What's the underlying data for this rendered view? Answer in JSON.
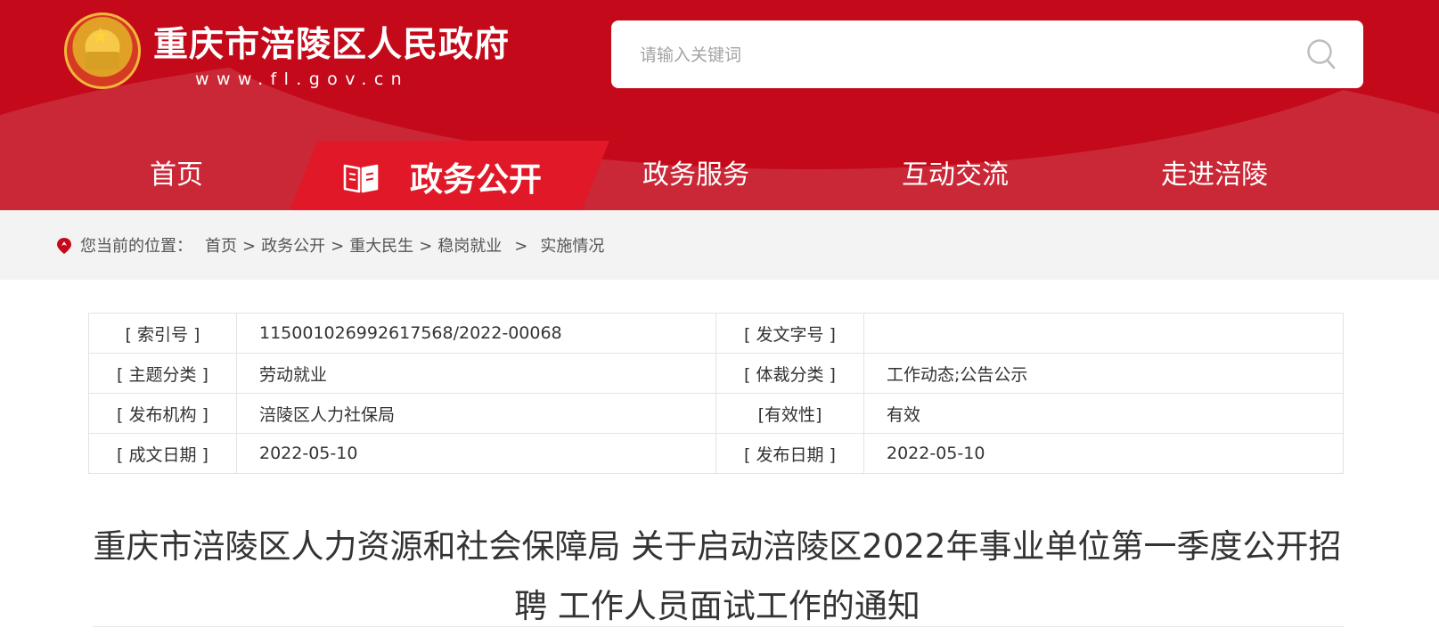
{
  "header": {
    "site_name": "重庆市涪陵区人民政府",
    "site_url": "www.fl.gov.cn",
    "search_placeholder": "请输入关键词",
    "brand_color": "#c3091a",
    "active_color": "#e11827"
  },
  "nav": {
    "items": [
      {
        "label": "首页"
      },
      {
        "label": "政务公开"
      },
      {
        "label": "政务服务"
      },
      {
        "label": "互动交流"
      },
      {
        "label": "走进涪陵"
      }
    ]
  },
  "breadcrumb": {
    "prefix": "您当前的位置：",
    "items": [
      "首页",
      "政务公开",
      "重大民生",
      "稳岗就业",
      "实施情况"
    ],
    "separator": ">"
  },
  "meta": {
    "rows": [
      [
        "[ 索引号 ]",
        "115001026992617568/2022-00068",
        "[ 发文字号 ]",
        ""
      ],
      [
        "[ 主题分类 ]",
        "劳动就业",
        "[ 体裁分类 ]",
        "工作动态;公告公示"
      ],
      [
        "[ 发布机构 ]",
        "涪陵区人力社保局",
        "[有效性]",
        "有效"
      ],
      [
        "[ 成文日期 ]",
        "2022-05-10",
        "[ 发布日期 ]",
        "2022-05-10"
      ]
    ]
  },
  "article": {
    "title_line1": "重庆市涪陵区人力资源和社会保障局 关于启动涪陵区2022年事业单位第一季度公开招",
    "title_line2": "聘 工作人员面试工作的通知"
  }
}
